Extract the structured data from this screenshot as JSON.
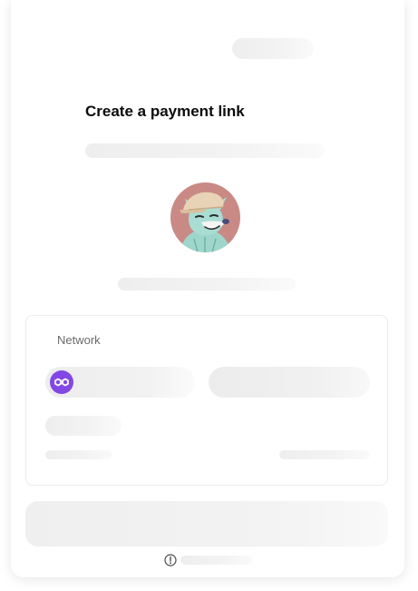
{
  "page": {
    "title": "Create a payment link"
  },
  "avatar": {
    "icon": "fox-avatar-icon",
    "background_color": "#c98a86"
  },
  "network_section": {
    "label": "Network",
    "selected_network_icon": "polygon-icon",
    "network_icon_color": "#8247e5"
  },
  "footer": {
    "icon": "info-icon"
  }
}
